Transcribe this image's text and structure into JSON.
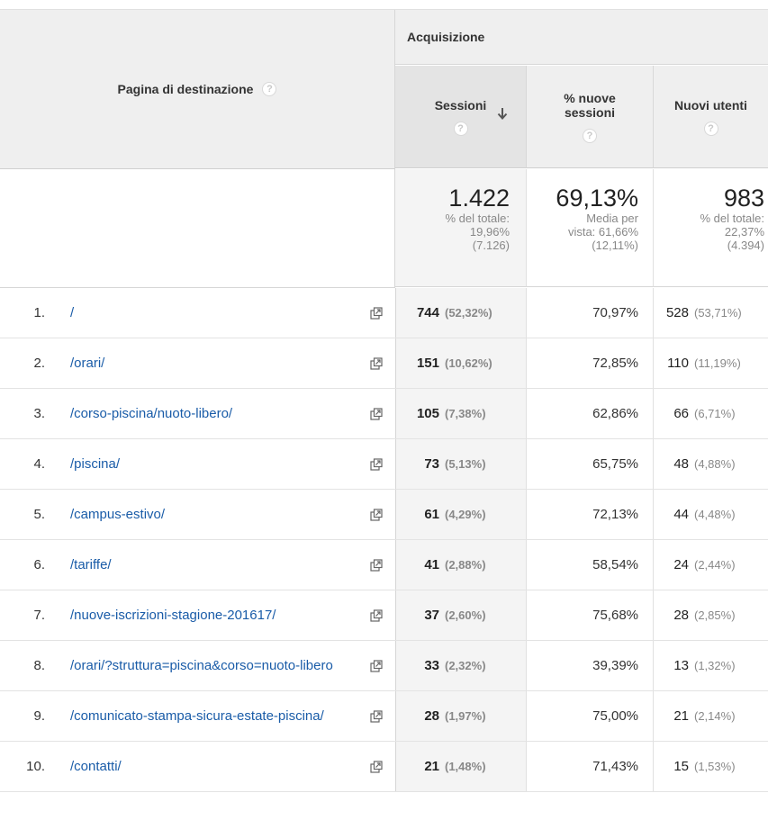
{
  "header": {
    "landing_page": "Pagina di destinazione",
    "group": "Acquisizione",
    "col_sessions": "Sessioni",
    "col_new_sessions_line1": "% nuove",
    "col_new_sessions_line2": "sessioni",
    "col_new_users": "Nuovi utenti",
    "help": "?"
  },
  "totals": {
    "sessions": {
      "value": "1.422",
      "l1": "% del totale:",
      "l2": "19,96%",
      "l3": "(7.126)"
    },
    "new_sessions": {
      "value": "69,13%",
      "l1": "Media per",
      "l2": "vista: 61,66%",
      "l3": "(12,11%)"
    },
    "new_users": {
      "value": "983",
      "l1": "% del totale:",
      "l2": "22,37%",
      "l3": "(4.394)"
    }
  },
  "rows": [
    {
      "num": "1.",
      "path": "/",
      "sessions": "744",
      "sessions_pct": "(52,32%)",
      "new_sessions": "70,97%",
      "new_users": "528",
      "new_users_pct": "(53,71%)"
    },
    {
      "num": "2.",
      "path": "/orari/",
      "sessions": "151",
      "sessions_pct": "(10,62%)",
      "new_sessions": "72,85%",
      "new_users": "110",
      "new_users_pct": "(11,19%)"
    },
    {
      "num": "3.",
      "path": "/corso-piscina/nuoto-libero/",
      "sessions": "105",
      "sessions_pct": "(7,38%)",
      "new_sessions": "62,86%",
      "new_users": "66",
      "new_users_pct": "(6,71%)"
    },
    {
      "num": "4.",
      "path": "/piscina/",
      "sessions": "73",
      "sessions_pct": "(5,13%)",
      "new_sessions": "65,75%",
      "new_users": "48",
      "new_users_pct": "(4,88%)"
    },
    {
      "num": "5.",
      "path": "/campus-estivo/",
      "sessions": "61",
      "sessions_pct": "(4,29%)",
      "new_sessions": "72,13%",
      "new_users": "44",
      "new_users_pct": "(4,48%)"
    },
    {
      "num": "6.",
      "path": "/tariffe/",
      "sessions": "41",
      "sessions_pct": "(2,88%)",
      "new_sessions": "58,54%",
      "new_users": "24",
      "new_users_pct": "(2,44%)"
    },
    {
      "num": "7.",
      "path": "/nuove-iscrizioni-stagione-201617/",
      "sessions": "37",
      "sessions_pct": "(2,60%)",
      "new_sessions": "75,68%",
      "new_users": "28",
      "new_users_pct": "(2,85%)"
    },
    {
      "num": "8.",
      "path": "/orari/?struttura=piscina&corso=nuoto-libero",
      "sessions": "33",
      "sessions_pct": "(2,32%)",
      "new_sessions": "39,39%",
      "new_users": "13",
      "new_users_pct": "(1,32%)"
    },
    {
      "num": "9.",
      "path": "/comunicato-stampa-sicura-estate-piscina/",
      "sessions": "28",
      "sessions_pct": "(1,97%)",
      "new_sessions": "75,00%",
      "new_users": "21",
      "new_users_pct": "(2,14%)"
    },
    {
      "num": "10.",
      "path": "/contatti/",
      "sessions": "21",
      "sessions_pct": "(1,48%)",
      "new_sessions": "71,43%",
      "new_users": "15",
      "new_users_pct": "(1,53%)"
    }
  ],
  "colors": {
    "link": "#1a5ca8",
    "header_bg": "#efefef",
    "sorted_bg": "#f4f4f4",
    "muted": "#888888"
  },
  "icons": {
    "help": "question-mark-circle",
    "sort": "arrow-down",
    "open_page": "external-link"
  }
}
